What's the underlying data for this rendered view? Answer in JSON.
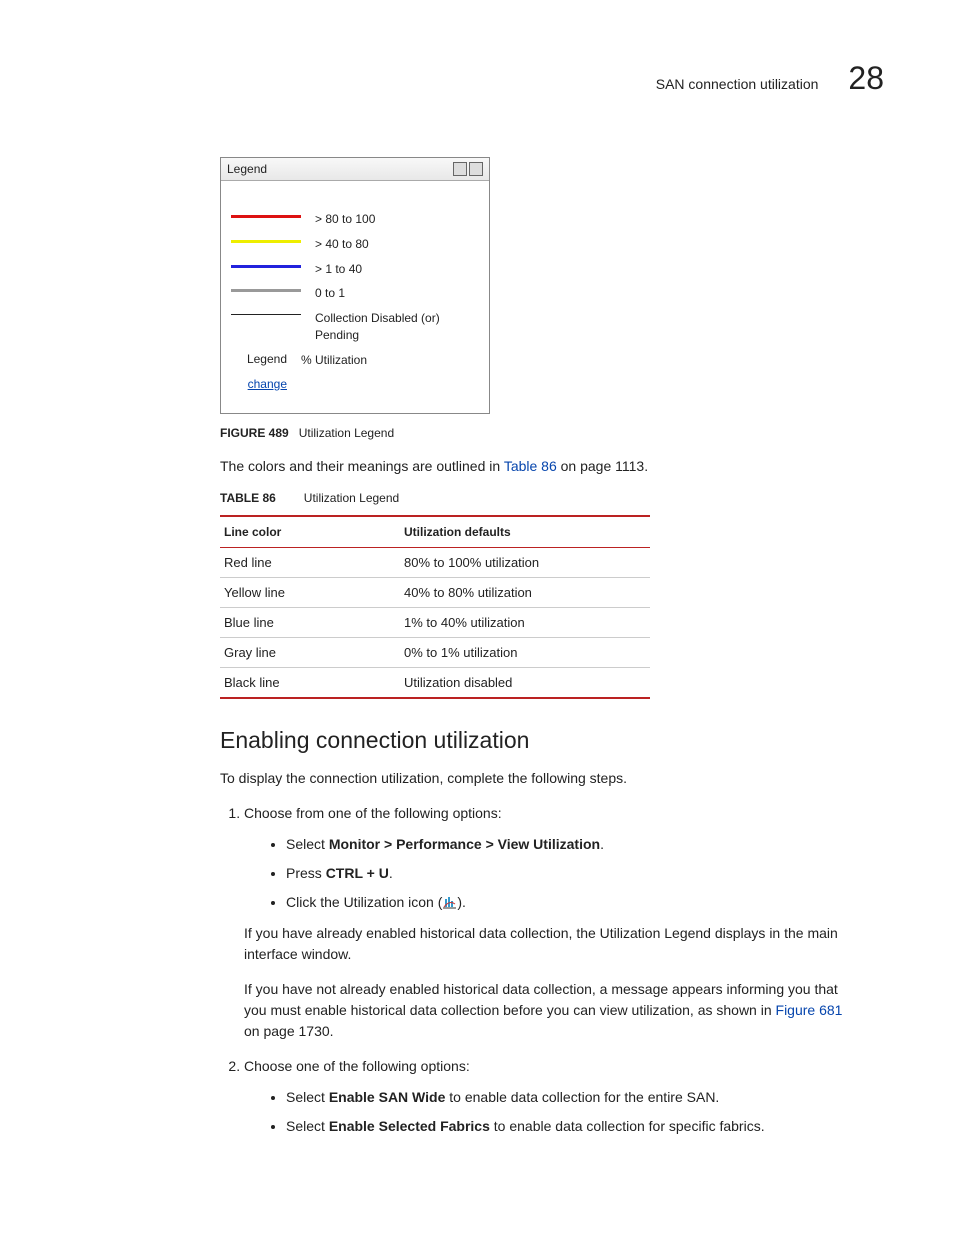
{
  "header": {
    "running_title": "SAN connection utilization",
    "chapter": "28"
  },
  "legend_box": {
    "title": "Legend",
    "rows": [
      {
        "color": "red",
        "label": "> 80 to 100"
      },
      {
        "color": "yellow",
        "label": "> 40 to 80"
      },
      {
        "color": "blue",
        "label": "> 1 to 40"
      },
      {
        "color": "gray",
        "label": "0 to 1"
      },
      {
        "color": "black",
        "label": "Collection Disabled (or) Pending"
      }
    ],
    "label_left": "Legend",
    "label_right": "% Utilization",
    "change": "change"
  },
  "figure": {
    "label": "FIGURE 489",
    "caption": "Utilization Legend"
  },
  "intro_para_1": "The colors and their meanings are outlined in ",
  "intro_link": "Table 86",
  "intro_para_2": " on page 1113.",
  "table_caption": {
    "label": "TABLE 86",
    "caption": "Utilization Legend"
  },
  "table": {
    "headers": [
      "Line color",
      "Utilization defaults"
    ],
    "rows": [
      [
        "Red line",
        "80% to 100% utilization"
      ],
      [
        "Yellow line",
        "40% to 80% utilization"
      ],
      [
        "Blue line",
        "1% to 40% utilization"
      ],
      [
        "Gray line",
        "0% to 1% utilization"
      ],
      [
        "Black line",
        "Utilization disabled"
      ]
    ]
  },
  "section_heading": "Enabling connection utilization",
  "section_intro": "To display the connection utilization, complete the following steps.",
  "steps": {
    "s1": {
      "text": "Choose from one of the following options:",
      "bullets": {
        "b1_pre": "Select ",
        "b1_bold": "Monitor > Performance > View Utilization",
        "b1_post": ".",
        "b2_pre": "Press ",
        "b2_bold": "CTRL + U",
        "b2_post": ".",
        "b3_pre": "Click the Utilization icon (",
        "b3_post": ")."
      },
      "after1": "If you have already enabled historical data collection, the Utilization Legend displays in the main interface window.",
      "after2_a": "If you have not already enabled historical data collection, a message appears informing you that you must enable historical data collection before you can view utilization, as shown in ",
      "after2_link": "Figure 681",
      "after2_b": " on page 1730."
    },
    "s2": {
      "text": "Choose one of the following options:",
      "bullets": {
        "b1_pre": "Select ",
        "b1_bold": "Enable SAN Wide",
        "b1_post": " to enable data collection for the entire SAN.",
        "b2_pre": "Select ",
        "b2_bold": "Enable Selected Fabrics",
        "b2_post": " to enable data collection for specific fabrics."
      }
    }
  }
}
